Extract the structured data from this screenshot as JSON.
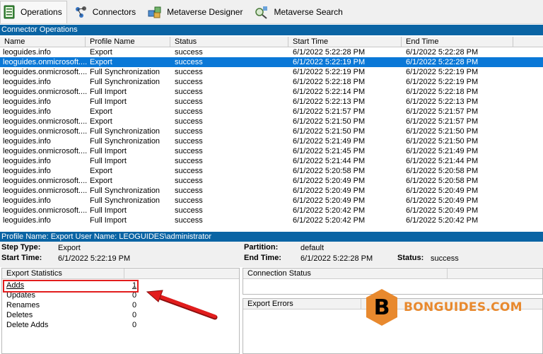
{
  "toolbar": {
    "items": [
      {
        "label": "Operations",
        "icon": "operations-icon"
      },
      {
        "label": "Connectors",
        "icon": "connectors-icon"
      },
      {
        "label": "Metaverse Designer",
        "icon": "metaverse-designer-icon"
      },
      {
        "label": "Metaverse Search",
        "icon": "metaverse-search-icon"
      }
    ]
  },
  "section_title": "Connector Operations",
  "columns": [
    "Name",
    "Profile Name",
    "Status",
    "Start Time",
    "End Time"
  ],
  "rows": [
    [
      "leoguides.info",
      "Export",
      "success",
      "6/1/2022 5:22:28 PM",
      "6/1/2022 5:22:28 PM"
    ],
    [
      "leoguides.onmicrosoft....",
      "Export",
      "success",
      "6/1/2022 5:22:19 PM",
      "6/1/2022 5:22:28 PM"
    ],
    [
      "leoguides.onmicrosoft....",
      "Full Synchronization",
      "success",
      "6/1/2022 5:22:19 PM",
      "6/1/2022 5:22:19 PM"
    ],
    [
      "leoguides.info",
      "Full Synchronization",
      "success",
      "6/1/2022 5:22:18 PM",
      "6/1/2022 5:22:19 PM"
    ],
    [
      "leoguides.onmicrosoft....",
      "Full Import",
      "success",
      "6/1/2022 5:22:14 PM",
      "6/1/2022 5:22:18 PM"
    ],
    [
      "leoguides.info",
      "Full Import",
      "success",
      "6/1/2022 5:22:13 PM",
      "6/1/2022 5:22:13 PM"
    ],
    [
      "leoguides.info",
      "Export",
      "success",
      "6/1/2022 5:21:57 PM",
      "6/1/2022 5:21:57 PM"
    ],
    [
      "leoguides.onmicrosoft....",
      "Export",
      "success",
      "6/1/2022 5:21:50 PM",
      "6/1/2022 5:21:57 PM"
    ],
    [
      "leoguides.onmicrosoft....",
      "Full Synchronization",
      "success",
      "6/1/2022 5:21:50 PM",
      "6/1/2022 5:21:50 PM"
    ],
    [
      "leoguides.info",
      "Full Synchronization",
      "success",
      "6/1/2022 5:21:49 PM",
      "6/1/2022 5:21:50 PM"
    ],
    [
      "leoguides.onmicrosoft....",
      "Full Import",
      "success",
      "6/1/2022 5:21:45 PM",
      "6/1/2022 5:21:49 PM"
    ],
    [
      "leoguides.info",
      "Full Import",
      "success",
      "6/1/2022 5:21:44 PM",
      "6/1/2022 5:21:44 PM"
    ],
    [
      "leoguides.info",
      "Export",
      "success",
      "6/1/2022 5:20:58 PM",
      "6/1/2022 5:20:58 PM"
    ],
    [
      "leoguides.onmicrosoft....",
      "Export",
      "success",
      "6/1/2022 5:20:49 PM",
      "6/1/2022 5:20:58 PM"
    ],
    [
      "leoguides.onmicrosoft....",
      "Full Synchronization",
      "success",
      "6/1/2022 5:20:49 PM",
      "6/1/2022 5:20:49 PM"
    ],
    [
      "leoguides.info",
      "Full Synchronization",
      "success",
      "6/1/2022 5:20:49 PM",
      "6/1/2022 5:20:49 PM"
    ],
    [
      "leoguides.onmicrosoft....",
      "Full Import",
      "success",
      "6/1/2022 5:20:42 PM",
      "6/1/2022 5:20:49 PM"
    ],
    [
      "leoguides.info",
      "Full Import",
      "success",
      "6/1/2022 5:20:42 PM",
      "6/1/2022 5:20:42 PM"
    ]
  ],
  "selected_row": 1,
  "profile_bar": "Profile Name: Export  User Name: LEOGUIDES\\administrator",
  "details": {
    "step_type_label": "Step Type:",
    "step_type_value": "Export",
    "start_time_label": "Start Time:",
    "start_time_value": "6/1/2022 5:22:19 PM",
    "partition_label": "Partition:",
    "partition_value": "default",
    "end_time_label": "End Time:",
    "end_time_value": "6/1/2022 5:22:28 PM",
    "status_label": "Status:",
    "status_value": "success"
  },
  "export_stats": {
    "header": "Export Statistics",
    "items": [
      {
        "name": "Adds",
        "value": "1"
      },
      {
        "name": "Updates",
        "value": "0"
      },
      {
        "name": "Renames",
        "value": "0"
      },
      {
        "name": "Deletes",
        "value": "0"
      },
      {
        "name": "Delete Adds",
        "value": "0"
      }
    ]
  },
  "connection_status_header": "Connection Status",
  "export_errors_header": "Export Errors",
  "watermark": {
    "letter": "B",
    "text": "BONGUIDES.COM"
  },
  "colors": {
    "selection": "#0a78d7",
    "section_bar": "#0a64a4",
    "highlight": "#e21d1d",
    "brand": "#e8892e"
  }
}
